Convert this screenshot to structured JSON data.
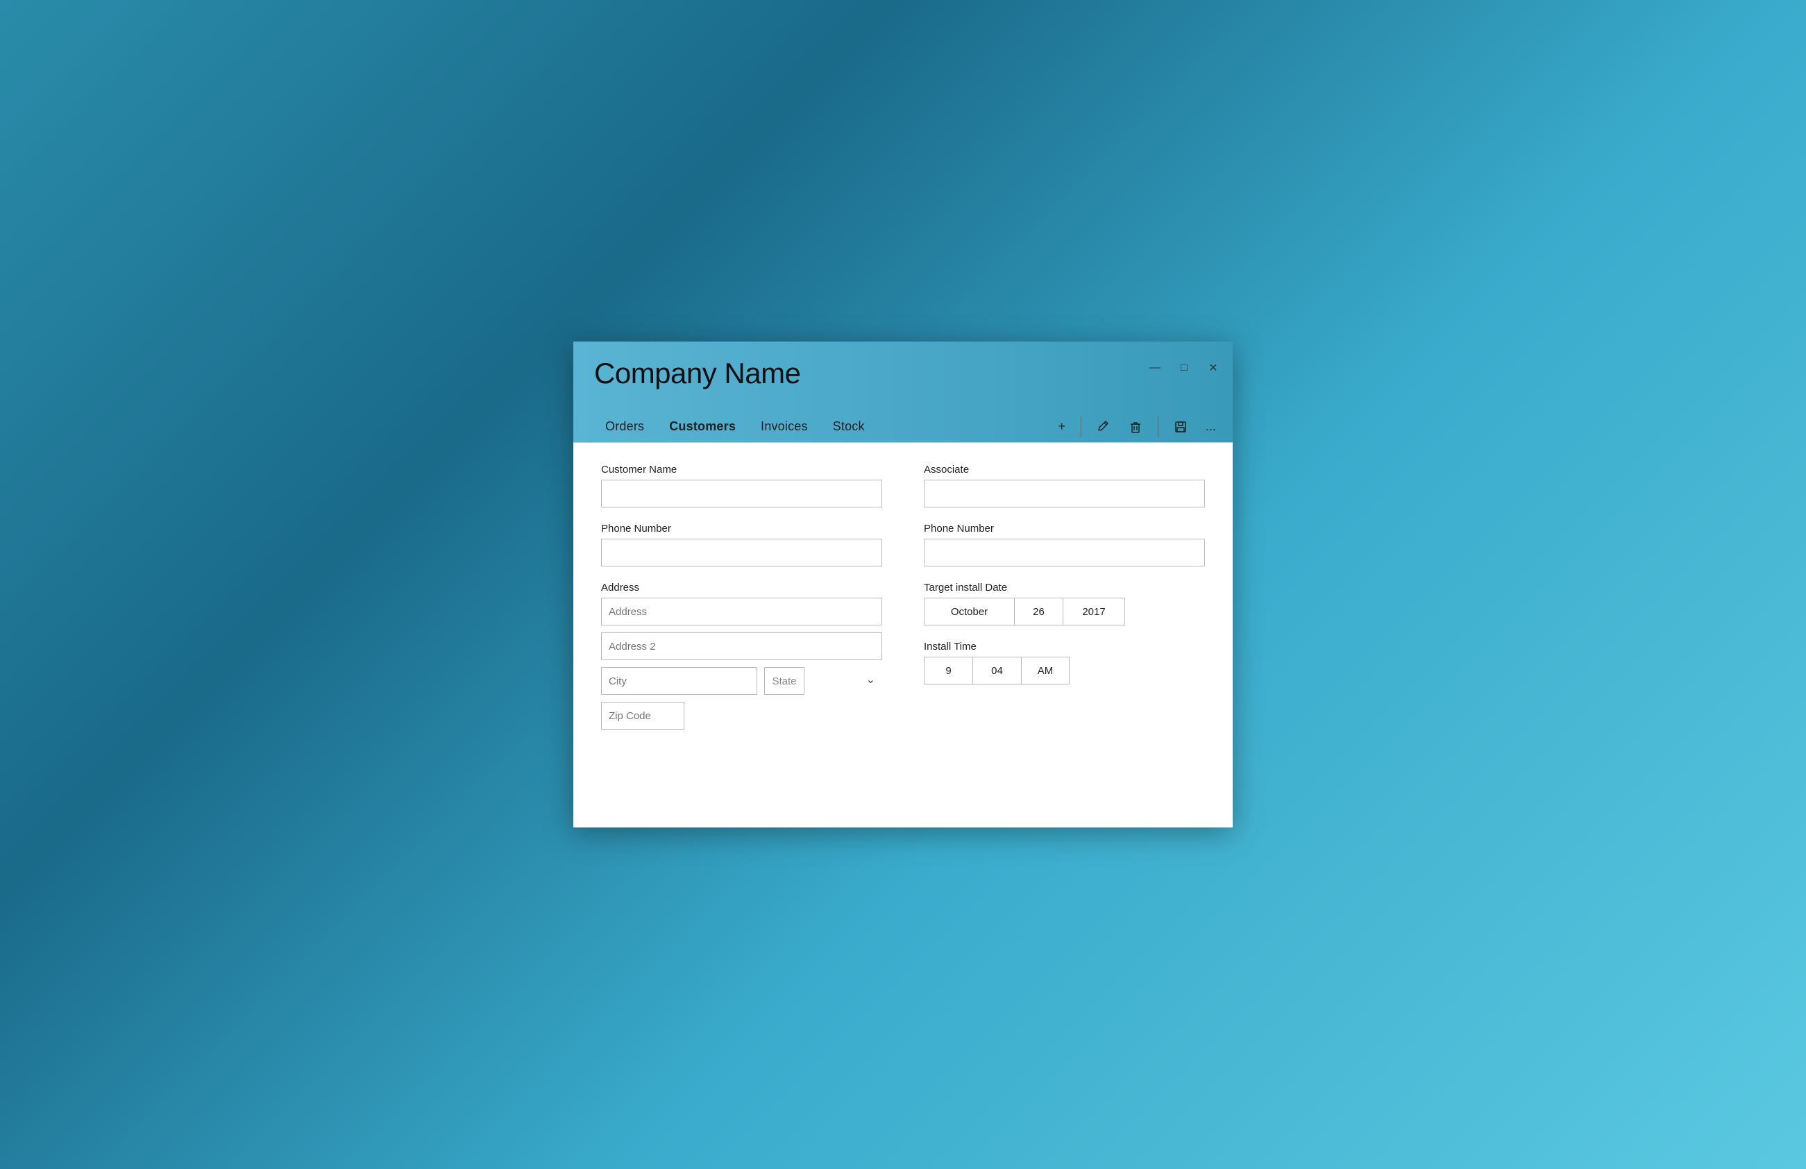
{
  "window": {
    "title": "Company Name",
    "controls": {
      "minimize": "—",
      "maximize": "□",
      "close": "✕"
    }
  },
  "nav": {
    "tabs": [
      {
        "id": "orders",
        "label": "Orders",
        "active": false
      },
      {
        "id": "customers",
        "label": "Customers",
        "active": true
      },
      {
        "id": "invoices",
        "label": "Invoices",
        "active": false
      },
      {
        "id": "stock",
        "label": "Stock",
        "active": false
      }
    ],
    "actions": {
      "add": "+",
      "edit": "edit",
      "delete": "delete",
      "save": "save",
      "more": "..."
    }
  },
  "form": {
    "customer_name_label": "Customer Name",
    "customer_name_value": "",
    "associate_label": "Associate",
    "associate_value": "",
    "customer_phone_label": "Phone Number",
    "customer_phone_value": "",
    "associate_phone_label": "Phone Number",
    "associate_phone_value": "",
    "address_label": "Address",
    "address_placeholder": "Address",
    "address2_placeholder": "Address 2",
    "city_placeholder": "City",
    "state_placeholder": "State",
    "zip_placeholder": "Zip Code",
    "target_date_label": "Target install Date",
    "date_month": "October",
    "date_day": "26",
    "date_year": "2017",
    "install_time_label": "Install Time",
    "time_hour": "9",
    "time_min": "04",
    "time_ampm": "AM"
  }
}
